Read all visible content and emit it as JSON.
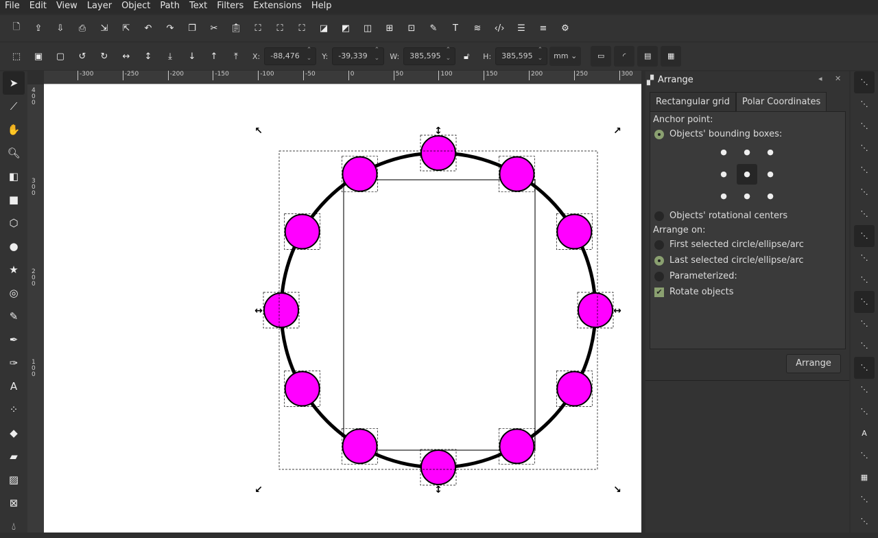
{
  "menu": [
    "File",
    "Edit",
    "View",
    "Layer",
    "Object",
    "Path",
    "Text",
    "Filters",
    "Extensions",
    "Help"
  ],
  "commands": [
    "new-icon",
    "open-icon",
    "save-icon",
    "print-icon",
    "import-icon",
    "export-icon",
    "undo-icon",
    "redo-icon",
    "copy-icon",
    "cut-icon",
    "paste-icon",
    "zoom-selection-icon",
    "zoom-drawing-icon",
    "zoom-page-icon",
    "duplicate-icon",
    "clone-icon",
    "unlink-icon",
    "group-icon",
    "ungroup-icon",
    "fill-stroke-icon",
    "text-font-icon",
    "layers-icon",
    "xml-editor-icon",
    "align-icon",
    "objects-icon",
    "preferences-icon"
  ],
  "controls": {
    "x_label": "X:",
    "x": "-88,476",
    "y_label": "Y:",
    "y": "-39,339",
    "w_label": "W:",
    "w": "385,595",
    "h_label": "H:",
    "h": "385,595",
    "unit": "mm"
  },
  "ruler": {
    "h": [
      "-300",
      "-250",
      "-200",
      "-150",
      "-100",
      "-50",
      "0",
      "50",
      "100",
      "150",
      "200",
      "250",
      "300"
    ],
    "v": [
      "400",
      "300",
      "200",
      "100"
    ]
  },
  "tools": [
    "selector",
    "node",
    "tweak",
    "zoom",
    "measure",
    "rectangle",
    "3d-box",
    "ellipse",
    "star",
    "spiral",
    "pencil",
    "pen",
    "calligraphy",
    "text",
    "spray",
    "eraser",
    "paint-bucket",
    "gradient",
    "mesh",
    "dropper"
  ],
  "panel": {
    "title": "Arrange",
    "tabs": [
      "Rectangular grid",
      "Polar Coordinates"
    ],
    "active_tab": 1,
    "anchor_label": "Anchor point:",
    "bbox_label": "Objects' bounding boxes:",
    "rot_label": "Objects' rotational centers",
    "arrange_on_label": "Arrange on:",
    "first_label": "First selected circle/ellipse/arc",
    "last_label": "Last selected circle/ellipse/arc",
    "param_label": "Parameterized:",
    "rotate_label": "Rotate objects",
    "rotate_checked": true,
    "anchor_selected": "center",
    "arrange_on": "last",
    "button": "Arrange"
  },
  "colors": {
    "fill": "#ff00ff",
    "accent": "#8aa070"
  }
}
